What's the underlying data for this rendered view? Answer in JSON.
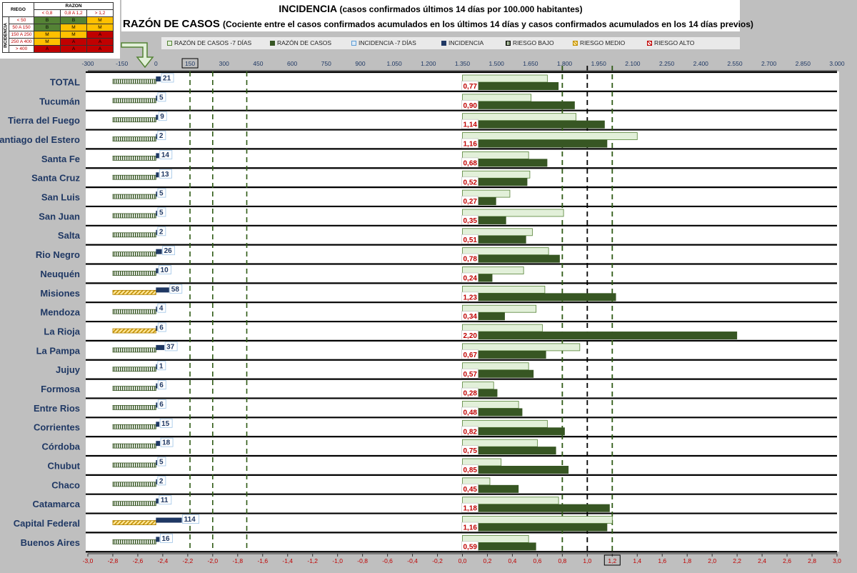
{
  "title": {
    "line1_main": "INCIDENCIA",
    "line1_sub": "(casos confirmados últimos 14 días por 100.000 habitantes)",
    "line2_main": "RAZÓN DE CASOS",
    "line2_sub": "(Cociente entre el casos confirmados acumulados en los últimos 14 días y casos confirmados acumulados en los 14 días previos)"
  },
  "legend": [
    {
      "label": "RAZÓN DE CASOS -7 DÍAS",
      "color": "#e2f0d9",
      "border": "#548235",
      "kind": "fill"
    },
    {
      "label": "RAZÓN DE CASOS",
      "color": "#375623",
      "border": "#375623",
      "kind": "fill"
    },
    {
      "label": "INCIDENCIA -7 DÍAS",
      "color": "#ddebf7",
      "border": "#5b9bd5",
      "kind": "fill"
    },
    {
      "label": "INCIDENCIA",
      "color": "#1f3864",
      "border": "#1f3864",
      "kind": "fill"
    },
    {
      "label": "RIESGO BAJO",
      "color": "#548235",
      "border": "#000000",
      "kind": "hatch-green"
    },
    {
      "label": "RIESGO MEDIO",
      "color": "#ffc000",
      "border": "#c09000",
      "kind": "hatch-yellow"
    },
    {
      "label": "RIESGO ALTO",
      "color": "#c00000",
      "border": "#c00000",
      "kind": "hatch-red"
    }
  ],
  "risk_table": {
    "corner": "RIEGO",
    "razon_header": "RAZON",
    "incidencia_header": "INCIDENCIA",
    "razon_cols": [
      "< 0,8",
      "0,8 A 1,2",
      "> 1,2"
    ],
    "rows": [
      {
        "label": "< 50",
        "cells": [
          "B",
          "B",
          "M"
        ],
        "colors": [
          "#548235",
          "#548235",
          "#ffc000"
        ]
      },
      {
        "label": "50 A 150",
        "cells": [
          "B",
          "M",
          "M"
        ],
        "colors": [
          "#548235",
          "#ffc000",
          "#ffc000"
        ]
      },
      {
        "label": "150 A 250",
        "cells": [
          "M",
          "M",
          "A"
        ],
        "colors": [
          "#ffc000",
          "#ffc000",
          "#c00000"
        ]
      },
      {
        "label": "250 A 400",
        "cells": [
          "M",
          "A",
          "A"
        ],
        "colors": [
          "#ffc000",
          "#c00000",
          "#c00000"
        ]
      },
      {
        "label": "> 400",
        "cells": [
          "A",
          "A",
          "A"
        ],
        "colors": [
          "#c00000",
          "#c00000",
          "#c00000"
        ]
      }
    ]
  },
  "chart_data": {
    "type": "bar",
    "orientation": "horizontal",
    "categories": [
      "TOTAL",
      "Tucumán",
      "Tierra del Fuego",
      "Santiago del Estero",
      "Santa Fe",
      "Santa Cruz",
      "San Luis",
      "San Juan",
      "Salta",
      "Rio Negro",
      "Neuquén",
      "Misiones",
      "Mendoza",
      "La Rioja",
      "La Pampa",
      "Jujuy",
      "Formosa",
      "Entre Rios",
      "Corrientes",
      "Córdoba",
      "Chubut",
      "Chaco",
      "Catamarca",
      "Capital Federal",
      "Buenos Aires"
    ],
    "incidencia": {
      "name": "INCIDENCIA",
      "values": [
        21,
        5,
        9,
        2,
        14,
        13,
        5,
        5,
        2,
        26,
        10,
        58,
        4,
        6,
        37,
        1,
        6,
        6,
        15,
        18,
        5,
        2,
        11,
        114,
        16
      ],
      "axis_top": {
        "min": -300,
        "max": 3000,
        "ticks": [
          "-300",
          "-150",
          "0",
          "150",
          "300",
          "450",
          "600",
          "750",
          "900",
          "1.050",
          "1.200",
          "1.350",
          "1.500",
          "1.650",
          "1.800",
          "1.950",
          "2.100",
          "2.250",
          "2.400",
          "2.550",
          "2.700",
          "2.850",
          "3.000"
        ]
      }
    },
    "riesgo": [
      "bajo",
      "bajo",
      "bajo",
      "bajo",
      "bajo",
      "bajo",
      "bajo",
      "bajo",
      "bajo",
      "bajo",
      "bajo",
      "medio",
      "bajo",
      "medio",
      "bajo",
      "bajo",
      "bajo",
      "bajo",
      "bajo",
      "bajo",
      "bajo",
      "bajo",
      "bajo",
      "medio",
      "bajo"
    ],
    "razon": {
      "name": "RAZÓN DE CASOS",
      "values": [
        0.77,
        0.9,
        1.14,
        1.16,
        0.68,
        0.52,
        0.27,
        0.35,
        0.51,
        0.78,
        0.24,
        1.23,
        0.34,
        2.2,
        0.67,
        0.57,
        0.28,
        0.48,
        0.82,
        0.75,
        0.85,
        0.45,
        1.18,
        1.16,
        0.59
      ],
      "labels": [
        "0,77",
        "0,90",
        "1,14",
        "1,16",
        "0,68",
        "0,52",
        "0,27",
        "0,35",
        "0,51",
        "0,78",
        "0,24",
        "1,23",
        "0,34",
        "2,20",
        "0,67",
        "0,57",
        "0,28",
        "0,48",
        "0,82",
        "0,75",
        "0,85",
        "0,45",
        "1,18",
        "1,16",
        "0,59"
      ]
    },
    "razon_7dias": {
      "name": "RAZÓN DE CASOS -7 DÍAS",
      "values": [
        0.68,
        0.55,
        0.91,
        1.4,
        0.53,
        0.54,
        0.38,
        0.81,
        0.56,
        0.69,
        0.49,
        0.66,
        0.59,
        0.64,
        0.94,
        0.53,
        0.25,
        0.45,
        0.68,
        0.6,
        0.31,
        0.22,
        0.77,
        1.2,
        0.53
      ]
    },
    "axis_bottom": {
      "min": -3.0,
      "max": 3.0,
      "ticks": [
        "-3,0",
        "-2,8",
        "-2,6",
        "-2,4",
        "-2,2",
        "-2,0",
        "-1,8",
        "-1,6",
        "-1,4",
        "-1,2",
        "-1,0",
        "-0,8",
        "-0,6",
        "-0,4",
        "-0,2",
        "0,0",
        "0,2",
        "0,4",
        "0,6",
        "0,8",
        "1,0",
        "1,2",
        "1,4",
        "1,6",
        "1,8",
        "2,0",
        "2,2",
        "2,4",
        "2,6",
        "2,8",
        "3,0"
      ]
    },
    "reference_lines_incidencia": [
      150,
      250,
      400
    ],
    "reference_lines_razon": [
      0.8,
      1.0,
      1.2
    ],
    "boxed_ticks": [
      "150",
      "1,2"
    ]
  }
}
